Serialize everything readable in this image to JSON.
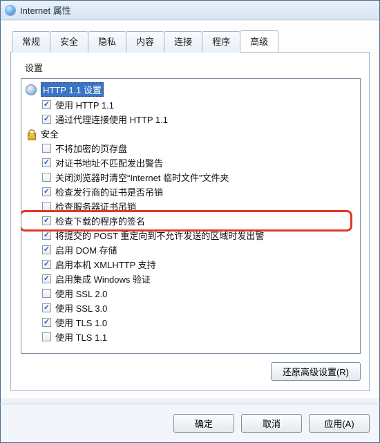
{
  "window": {
    "title": "Internet 属性"
  },
  "tabs": [
    {
      "label": "常规"
    },
    {
      "label": "安全"
    },
    {
      "label": "隐私"
    },
    {
      "label": "内容"
    },
    {
      "label": "连接"
    },
    {
      "label": "程序"
    },
    {
      "label": "高级"
    }
  ],
  "active_tab_index": 6,
  "settings_label": "设置",
  "tree": {
    "categories": [
      {
        "icon": "gear-icon",
        "label": "HTTP 1.1 设置",
        "selected": true,
        "items": [
          {
            "checked": true,
            "label": "使用 HTTP 1.1"
          },
          {
            "checked": true,
            "label": "通过代理连接使用 HTTP 1.1"
          }
        ]
      },
      {
        "icon": "lock-icon",
        "label": "安全",
        "selected": false,
        "items": [
          {
            "checked": false,
            "label": "不将加密的页存盘"
          },
          {
            "checked": true,
            "label": "对证书地址不匹配发出警告"
          },
          {
            "checked": false,
            "label": "关闭浏览器时清空“Internet 临时文件”文件夹"
          },
          {
            "checked": true,
            "label": "检查发行商的证书是否吊销"
          },
          {
            "checked": false,
            "label": "检查服务器证书吊销"
          },
          {
            "checked": true,
            "label": "检查下载的程序的签名",
            "highlight": true
          },
          {
            "checked": true,
            "label": "将提交的 POST 重定向到不允许发送的区域时发出警"
          },
          {
            "checked": true,
            "label": "启用 DOM 存储"
          },
          {
            "checked": true,
            "label": "启用本机 XMLHTTP 支持"
          },
          {
            "checked": true,
            "label": "启用集成 Windows 验证"
          },
          {
            "checked": false,
            "label": "使用 SSL 2.0"
          },
          {
            "checked": true,
            "label": "使用 SSL 3.0"
          },
          {
            "checked": true,
            "label": "使用 TLS 1.0"
          },
          {
            "checked": false,
            "label": "使用 TLS 1.1"
          }
        ]
      }
    ]
  },
  "buttons": {
    "restore": "还原高级设置(R)",
    "ok": "确定",
    "cancel": "取消",
    "apply": "应用(A)"
  }
}
